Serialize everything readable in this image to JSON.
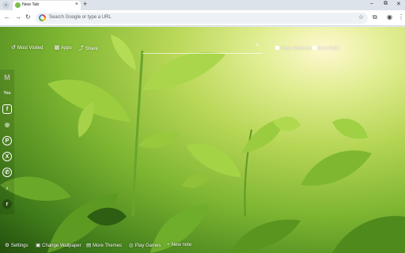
{
  "browser": {
    "tab_title": "New Tab",
    "omnibox_placeholder": "Search Google or type a URL"
  },
  "topbar": {
    "most_visited": "Most Visited",
    "apps": "Apps",
    "share": "Share",
    "show_shortcuts": "Show Shortcuts",
    "dark_mode": "Dark Mode"
  },
  "social": [
    {
      "name": "gmail",
      "label": "M",
      "color": "#c2c2c2"
    },
    {
      "name": "youtube",
      "label": "You",
      "color": "#d9d9d9"
    },
    {
      "name": "facebook",
      "label": "f",
      "color": "#ffffff"
    },
    {
      "name": "instagram",
      "label": "◎",
      "color": "#ffffff"
    },
    {
      "name": "pinterest",
      "label": "P",
      "color": "#ffffff"
    },
    {
      "name": "x",
      "label": "X",
      "color": "#ffffff"
    },
    {
      "name": "whatsapp",
      "label": "✆",
      "color": "#ffffff"
    },
    {
      "name": "tiktok",
      "label": "♪",
      "color": "#ffffff"
    },
    {
      "name": "reddit",
      "label": "r",
      "color": "#ffffff"
    }
  ],
  "bottombar": {
    "settings": "Settings",
    "change_wallpaper": "Change Wallpaper",
    "more_themes": "More Themes",
    "play_games": "Play Games",
    "new_note": "New note"
  }
}
